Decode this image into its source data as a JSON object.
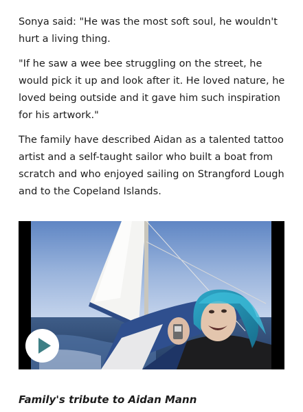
{
  "article": {
    "paragraphs": [
      "Sonya said: \"He was the most soft soul, he wouldn't hurt a living thing.",
      "\"If he saw a wee bee struggling on the street, he would pick it up and look after it. He loved nature, he loved being outside and it gave him such inspiration for his artwork.\"",
      "The family have described Aidan as a talented tattoo artist and a self-taught sailor who built a boat from scratch and who enjoyed sailing on Strangford Lough and to the Copeland Islands."
    ]
  },
  "video": {
    "play_icon": "play-icon",
    "caption": "Family's tribute to Aidan Mann"
  },
  "colors": {
    "play_triangle": "#3e7f85",
    "text": "#1c1c1c"
  }
}
